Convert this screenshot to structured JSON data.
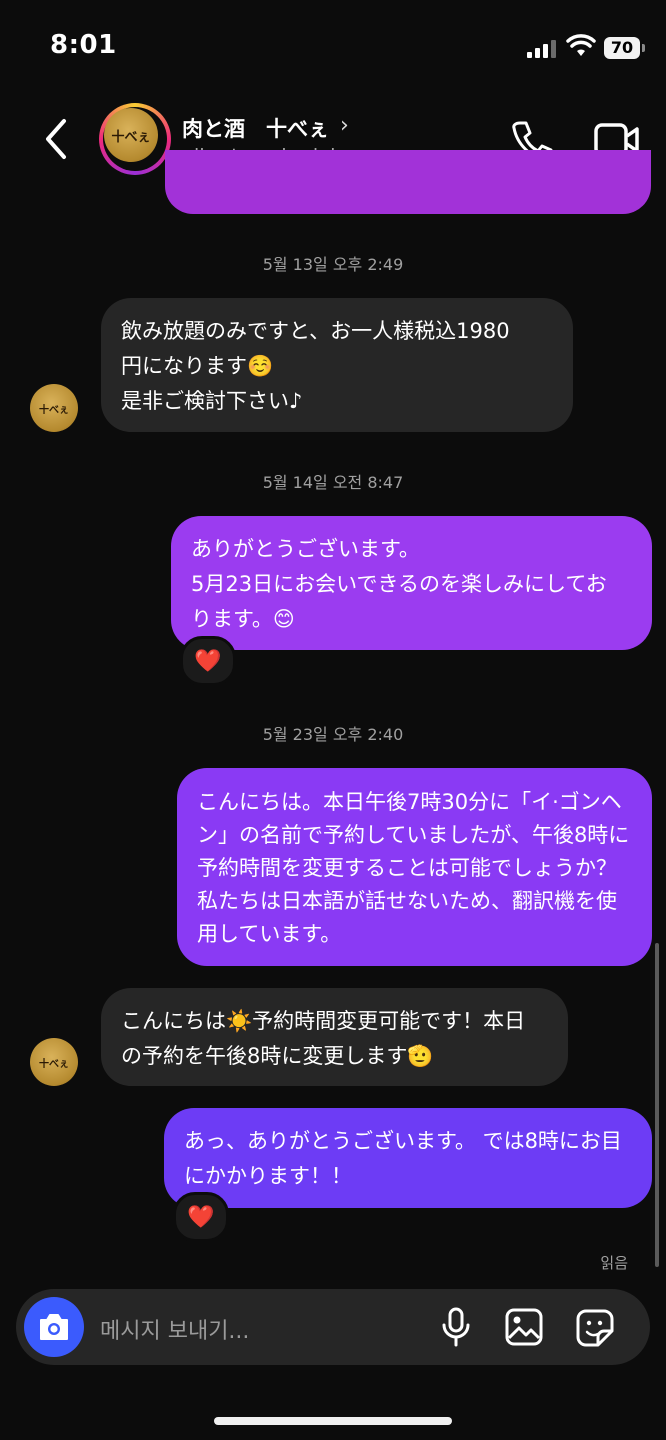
{
  "status_bar": {
    "time": "8:01",
    "battery": "70"
  },
  "header": {
    "name": "肉と酒　十べぇ",
    "username": "niku_to_sake_jube",
    "avatar_text": "十べぇ"
  },
  "messages": [
    {
      "type": "timestamp",
      "text": "5월 13일 오후 2:49"
    },
    {
      "type": "incoming",
      "lines": [
        "飲み放題のみですと、お一人様税込1980",
        "円になります☺️",
        "是非ご検討下さい♪"
      ]
    },
    {
      "type": "timestamp",
      "text": "5월 14일 오전 8:47"
    },
    {
      "type": "outgoing",
      "lines": [
        "ありがとうございます。",
        "5月23日にお会いできるのを楽しみにしてお",
        "ります。😊"
      ],
      "reaction": "❤️"
    },
    {
      "type": "timestamp",
      "text": "5월 23일 오후 2:40"
    },
    {
      "type": "outgoing",
      "lines": [
        "こんにちは。本日午後7時30分に「イ·ゴンヘ",
        "ン」の名前で予約していましたが、午後8時に",
        "予約時間を変更することは可能でしょうか？",
        "私たちは日本語が話せないため、翻訳機を使",
        "用しています。"
      ]
    },
    {
      "type": "incoming",
      "lines": [
        "こんにちは☀️予約時間変更可能です！本日",
        "の予約を午後8時に変更します🫡"
      ]
    },
    {
      "type": "outgoing",
      "lines": [
        "あっ、ありがとうございます。 では8時にお目",
        "にかかります！！"
      ],
      "reaction": "❤️"
    }
  ],
  "read_receipt": "읽음",
  "composer": {
    "placeholder": "메시지 보내기..."
  },
  "colors": {
    "bubble_in": "#262626",
    "bubble_out_1": "#9b3cf0",
    "bubble_out_2": "#8a3af4",
    "bubble_out_3": "#6d3cf5",
    "camera": "#3b5bfd"
  }
}
